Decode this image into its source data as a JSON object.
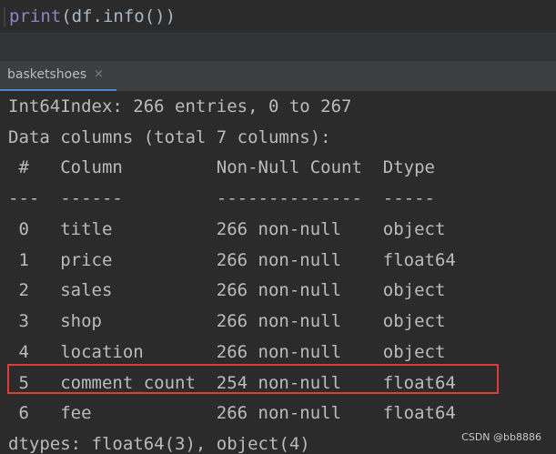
{
  "editor": {
    "code_keyword": "print",
    "code_rest": "(df.info())"
  },
  "run_tab": {
    "label": "basketshoes",
    "close_glyph": "×"
  },
  "console": {
    "lines": [
      "Int64Index: 266 entries, 0 to 267",
      "Data columns (total 7 columns):",
      " #   Column         Non-Null Count  Dtype  ",
      "---  ------         --------------  -----  ",
      " 0   title          266 non-null    object ",
      " 1   price          266 non-null    float64",
      " 2   sales          266 non-null    object ",
      " 3   shop           266 non-null    object ",
      " 4   location       266 non-null    object ",
      " 5   comment_count  254 non-null    float64",
      " 6   fee            266 non-null    float64",
      "dtypes: float64(3), object(4)"
    ],
    "highlight_color": "#e03a3a"
  },
  "watermark": "CSDN @bb8886"
}
